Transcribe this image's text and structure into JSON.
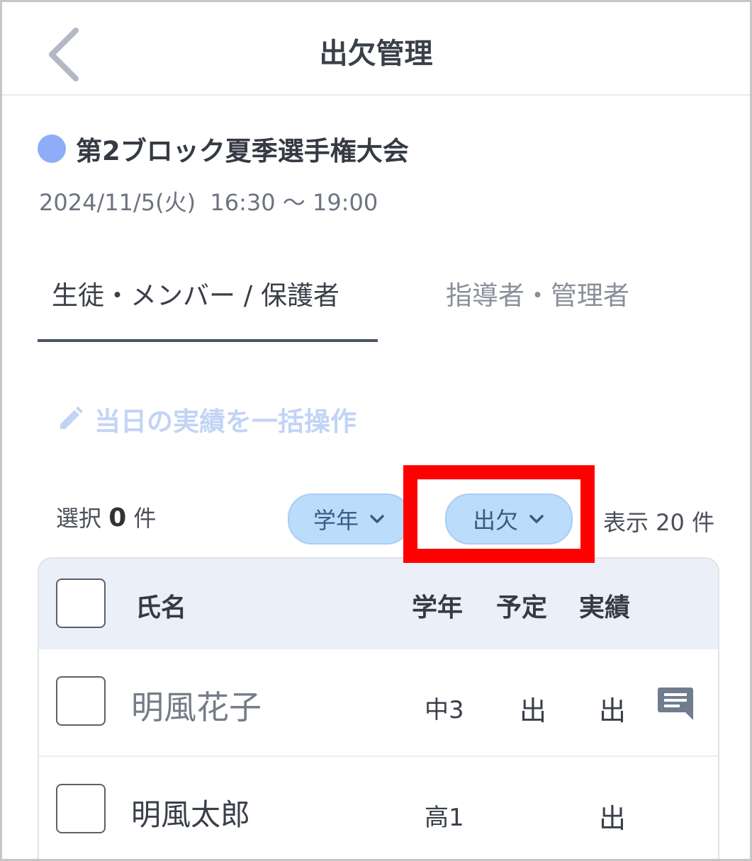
{
  "header": {
    "title": "出欠管理"
  },
  "event": {
    "name": "第2ブロック夏季選手権大会",
    "datetime": "2024/11/5(火)  16:30 〜 19:00",
    "dot_color": "#8eacf7"
  },
  "tabs": [
    {
      "label": "生徒・メンバー / 保護者",
      "active": true
    },
    {
      "label": "指導者・管理者",
      "active": false
    }
  ],
  "bulk_action": {
    "label": "当日の実績を一括操作"
  },
  "toolbar": {
    "selected_prefix": "選択",
    "selected_count": "0",
    "selected_suffix": "件",
    "filter_grade": "学年",
    "filter_attendance": "出欠",
    "display_count": "表示 20 件"
  },
  "table": {
    "headers": {
      "name": "氏名",
      "grade": "学年",
      "planned": "予定",
      "actual": "実績"
    },
    "rows": [
      {
        "name": "明風花子",
        "grade": "中3",
        "planned": "出",
        "actual": "出",
        "has_memo": true
      },
      {
        "name": "明風太郎",
        "grade": "高1",
        "planned": "",
        "actual": "出",
        "has_memo": false
      }
    ]
  },
  "colors": {
    "highlight": "#ff0000",
    "chip": "#bcdcfb"
  }
}
